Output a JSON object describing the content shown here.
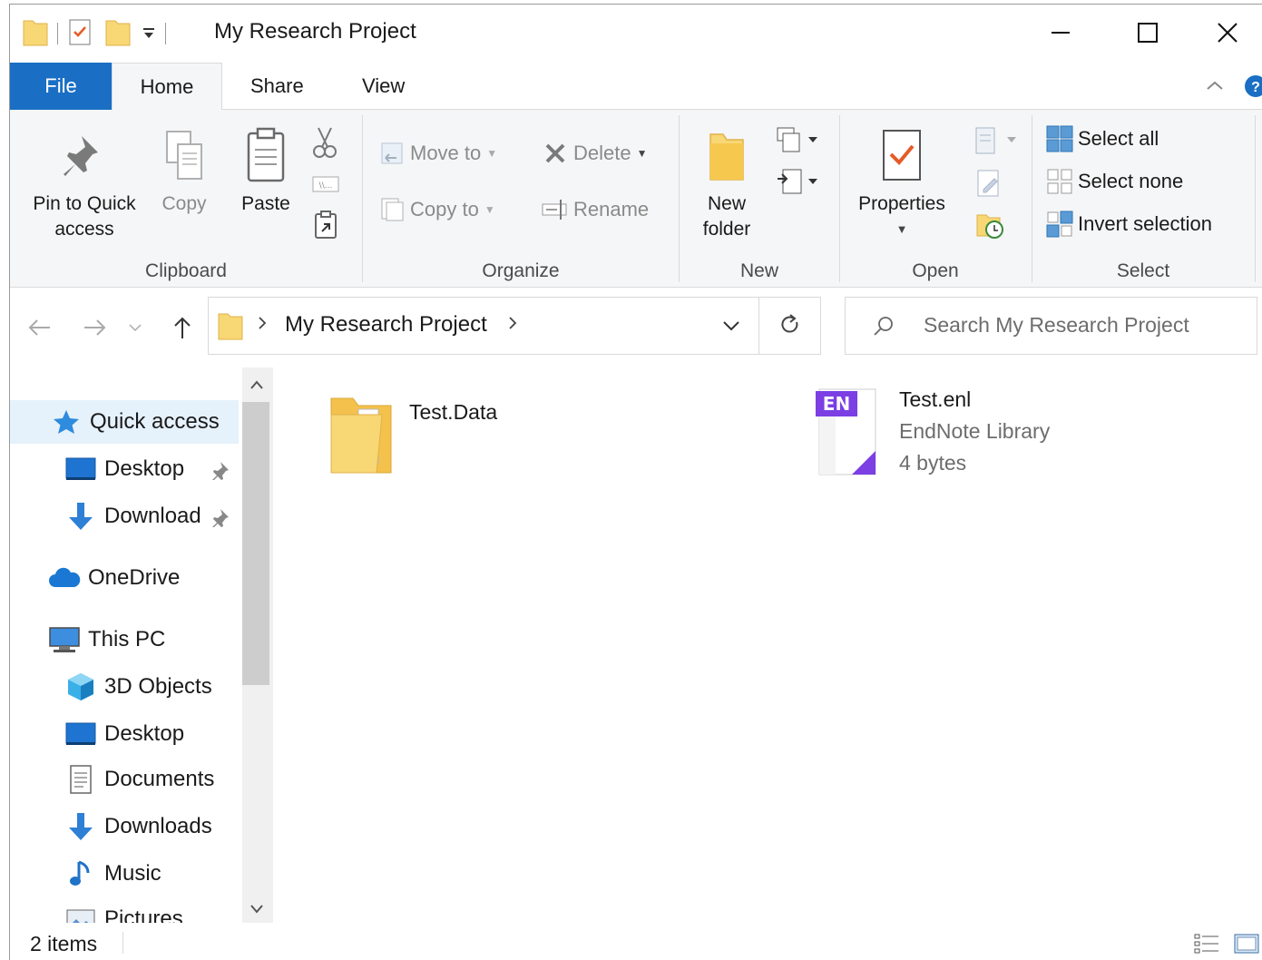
{
  "window": {
    "title": "My Research Project",
    "accent": "#1a6fc4"
  },
  "ribbon_tabs": {
    "file": "File",
    "home": "Home",
    "share": "Share",
    "view": "View"
  },
  "ribbon": {
    "clipboard": {
      "label": "Clipboard",
      "pin_line1": "Pin to Quick",
      "pin_line2": "access",
      "copy": "Copy",
      "paste": "Paste"
    },
    "organize": {
      "label": "Organize",
      "move_to": "Move to",
      "copy_to": "Copy to",
      "delete": "Delete",
      "rename": "Rename"
    },
    "new": {
      "label": "New",
      "new_folder_line1": "New",
      "new_folder_line2": "folder"
    },
    "open": {
      "label": "Open",
      "properties": "Properties"
    },
    "select": {
      "label": "Select",
      "select_all": "Select all",
      "select_none": "Select none",
      "invert_selection": "Invert selection"
    }
  },
  "address": {
    "path": "My Research Project",
    "search_placeholder": "Search My Research Project"
  },
  "nav_pane": {
    "items": [
      {
        "label": "Quick access",
        "icon": "star-icon"
      },
      {
        "label": "Desktop",
        "icon": "desktop-icon"
      },
      {
        "label": "Download",
        "icon": "download-icon"
      },
      {
        "label": "OneDrive",
        "icon": "cloud-icon"
      },
      {
        "label": "This PC",
        "icon": "computer-icon"
      },
      {
        "label": "3D Objects",
        "icon": "cube-icon"
      },
      {
        "label": "Desktop",
        "icon": "desktop-icon"
      },
      {
        "label": "Documents",
        "icon": "document-icon"
      },
      {
        "label": "Downloads",
        "icon": "download-icon"
      },
      {
        "label": "Music",
        "icon": "music-icon"
      },
      {
        "label": "Pictures",
        "icon": "pictures-icon"
      }
    ]
  },
  "files": [
    {
      "name": "Test.Data",
      "type": "folder"
    },
    {
      "name": "Test.enl",
      "type_label": "EndNote Library",
      "size": "4 bytes",
      "badge": "EN"
    }
  ],
  "status": {
    "item_count": "2 items"
  }
}
